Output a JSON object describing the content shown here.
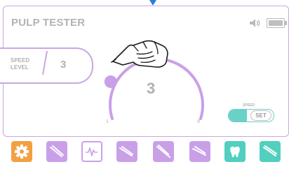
{
  "header": {
    "title": "PULP TESTER"
  },
  "speed_panel": {
    "label_line1": "SPEED",
    "label_line2": "LEVEL",
    "value": "3"
  },
  "dial": {
    "value": "3",
    "min_label": "1",
    "max_label": "9",
    "level": 3,
    "min": 1,
    "max": 9
  },
  "speed_toggle": {
    "caption": "SPEED",
    "button_label": "SET"
  },
  "colors": {
    "accent_purple": "#c9a0e8",
    "orange": "#f2a043",
    "teal": "#52cfbe",
    "frame_border": "#c9a6e0",
    "text_gray": "#b0b0b0"
  },
  "toolbar": {
    "items": [
      {
        "icon": "gear-icon"
      },
      {
        "icon": "dental-tool-icon"
      },
      {
        "icon": "pulp-test-icon"
      },
      {
        "icon": "dental-tool-icon"
      },
      {
        "icon": "dental-tool-icon"
      },
      {
        "icon": "dental-tool-icon"
      },
      {
        "icon": "tooth-icon"
      },
      {
        "icon": "dental-tool-icon"
      }
    ]
  }
}
